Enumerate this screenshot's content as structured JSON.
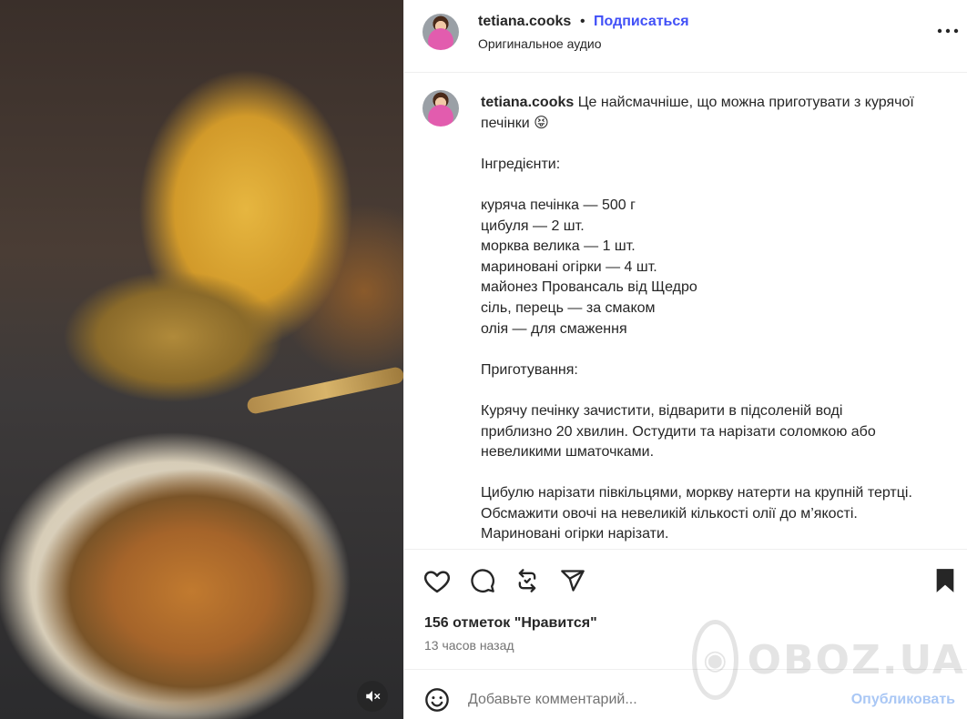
{
  "post": {
    "username": "tetiana.cooks",
    "separator": "•",
    "follow_label": "Подписаться",
    "audio_label": "Оригинальное аудио"
  },
  "caption": {
    "username": "tetiana.cooks",
    "text": " Це найсмачніше, що можна приготувати з курячої печінки 😝\n\nІнгредієнти:\n\nкуряча печінка — 500 г\nцибуля — 2 шт.\nморква велика — 1 шт.\nмариновані огірки — 4 шт.\nмайонез Провансаль від Щедро\nсіль, перець — за смаком\nолія — для смаження\n\nПриготування:\n\nКурячу печінку зачистити, відварити в підсоленій воді приблизно 20 хвилин. Остудити та нарізати соломкою або невеликими шматочками.\n\nЦибулю нарізати півкільцями, моркву натерти на крупній тертці. Обсмажити овочі на невеликій кількості олії до м’якості.\nМариновані огірки нарізати."
  },
  "stats": {
    "likes": "156 отметок \"Нравится\"",
    "time_ago": "13 часов назад"
  },
  "comment": {
    "placeholder": "Добавьте комментарий...",
    "post_label": "Опубликовать"
  },
  "icons": {
    "more": "more-options-icon",
    "like": "heart-icon",
    "comment": "comment-icon",
    "repost": "repost-icon",
    "share": "share-icon",
    "save": "bookmark-icon",
    "emoji": "emoji-icon",
    "mute": "muted-speaker-icon"
  },
  "watermark": {
    "text": "OBOZ.UA"
  },
  "colors": {
    "follow": "#4150f7",
    "post_disabled": "#a9c7f5",
    "muted_text": "#737373"
  }
}
